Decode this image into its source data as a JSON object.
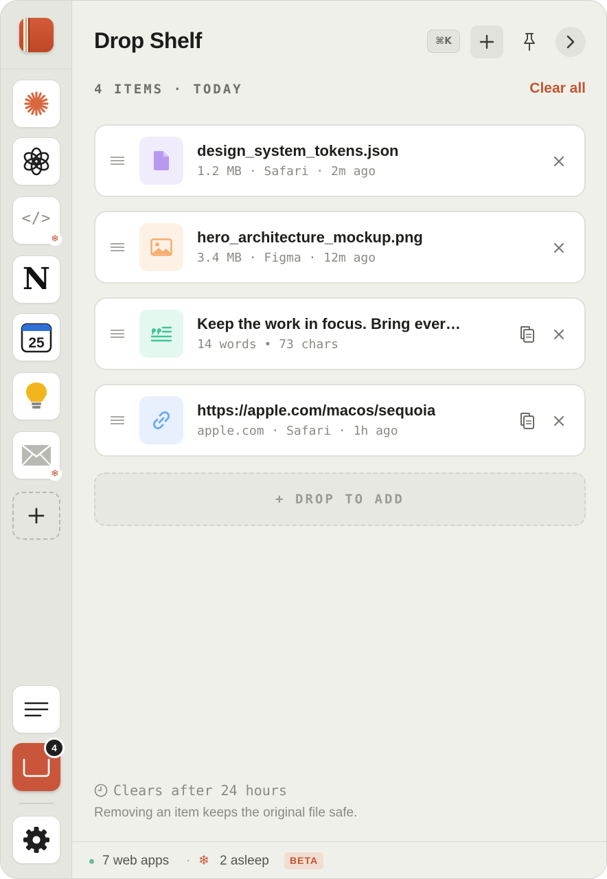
{
  "header": {
    "title": "Drop Shelf",
    "shortcut": "⌘K"
  },
  "section": {
    "label": "4 ITEMS · TODAY",
    "clear_all": "Clear all"
  },
  "items": [
    {
      "name": "design_system_tokens.json",
      "meta": "1.2 MB · Safari · 2m ago",
      "type": "file-icon",
      "accent": "#b79af0"
    },
    {
      "name": "hero_architecture_mockup.png",
      "meta": "3.4 MB · Figma · 12m ago",
      "type": "image-icon",
      "accent": "#f5ad6e"
    },
    {
      "name": "Keep the work in focus. Bring ever…",
      "meta": "14 words • 73 chars",
      "type": "quote-icon",
      "accent": "#3fc59a"
    },
    {
      "name": "https://apple.com/macos/sequoia",
      "meta": "apple.com · Safari · 1h ago",
      "type": "link-icon",
      "accent": "#6aa8f0"
    }
  ],
  "drop_zone": {
    "label": "+ DROP TO ADD"
  },
  "retention": {
    "label": "Clears after 24 hours",
    "note": "Removing an item keeps the original file safe."
  },
  "sidebar": {
    "apps": [
      {
        "name": "Claude",
        "icon": "sparkle-icon"
      },
      {
        "name": "ChatGPT",
        "icon": "openai-icon"
      },
      {
        "name": "Code",
        "icon": "code-icon",
        "label": "</>",
        "asleep": true
      },
      {
        "name": "Notion",
        "icon": "notion-icon",
        "label": "N"
      },
      {
        "name": "Calendar",
        "icon": "calendar-icon",
        "label": "25"
      },
      {
        "name": "Ideas",
        "icon": "lightbulb-icon"
      },
      {
        "name": "Mail",
        "icon": "mail-icon",
        "asleep": true
      }
    ],
    "shelf_badge": "4"
  },
  "footer": {
    "apps": "7 web apps",
    "separator": "·",
    "asleep": "2 asleep",
    "beta": "BETA"
  },
  "colors": {
    "accent": "#c4552f",
    "shelf": "#c9563a",
    "online": "#6cba91"
  }
}
